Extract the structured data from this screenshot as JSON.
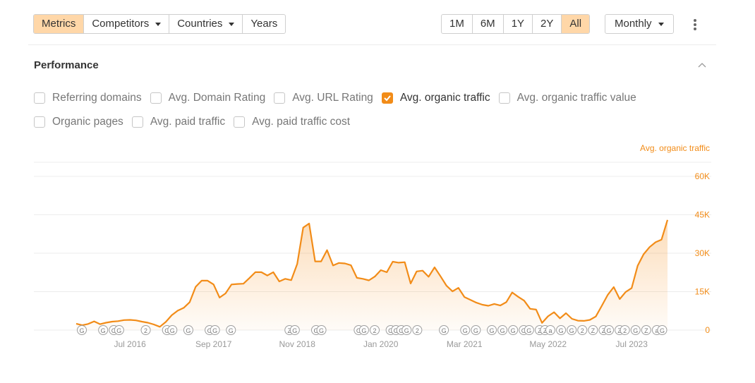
{
  "toolbar": {
    "left_segment": [
      {
        "label": "Metrics",
        "active": true,
        "dropdown": false
      },
      {
        "label": "Competitors",
        "active": false,
        "dropdown": true
      },
      {
        "label": "Countries",
        "active": false,
        "dropdown": true
      },
      {
        "label": "Years",
        "active": false,
        "dropdown": false
      }
    ],
    "range_segment": [
      {
        "label": "1M",
        "active": false
      },
      {
        "label": "6M",
        "active": false
      },
      {
        "label": "1Y",
        "active": false
      },
      {
        "label": "2Y",
        "active": false
      },
      {
        "label": "All",
        "active": true
      }
    ],
    "interval_label": "Monthly"
  },
  "section": {
    "title": "Performance"
  },
  "metrics_row1": [
    {
      "label": "Referring domains",
      "checked": false
    },
    {
      "label": "Avg. Domain Rating",
      "checked": false
    },
    {
      "label": "Avg. URL Rating",
      "checked": false
    },
    {
      "label": "Avg. organic traffic",
      "checked": true
    },
    {
      "label": "Avg. organic traffic value",
      "checked": false
    }
  ],
  "metrics_row2": [
    {
      "label": "Organic pages",
      "checked": false
    },
    {
      "label": "Avg. paid traffic",
      "checked": false
    },
    {
      "label": "Avg. paid traffic cost",
      "checked": false
    }
  ],
  "colors": {
    "accent": "#f28c18",
    "active_bg": "#ffd7a8",
    "grid": "#ececec",
    "tick_text": "#999999"
  },
  "chart_data": {
    "type": "area",
    "series": [
      {
        "name": "Avg. organic traffic",
        "values": [
          2500,
          1900,
          2400,
          3400,
          2300,
          2900,
          3300,
          3500,
          3900,
          4000,
          3800,
          3300,
          2900,
          2200,
          1300,
          3200,
          5800,
          7600,
          8700,
          10900,
          16900,
          19300,
          19300,
          17800,
          12700,
          14300,
          17800,
          18000,
          18100,
          20300,
          22600,
          22600,
          21300,
          22600,
          19000,
          20000,
          19500,
          25800,
          40000,
          41600,
          26800,
          26800,
          31200,
          25200,
          26200,
          26000,
          25300,
          20400,
          20000,
          19400,
          20900,
          23400,
          22600,
          26700,
          26300,
          26500,
          18200,
          22900,
          23200,
          20800,
          24500,
          21000,
          17300,
          15100,
          16500,
          12900,
          11800,
          10700,
          9900,
          9500,
          10200,
          9600,
          10900,
          14700,
          13000,
          11500,
          8300,
          8000,
          2800,
          5400,
          7000,
          4600,
          6600,
          4400,
          3700,
          3600,
          4000,
          5300,
          9500,
          13800,
          16800,
          12100,
          14900,
          16400,
          25100,
          29600,
          32400,
          34300,
          35300,
          43000
        ]
      }
    ],
    "x_tick_labels": [
      "Jul 2016",
      "Sep 2017",
      "Nov 2018",
      "Jan 2020",
      "Mar 2021",
      "May 2022",
      "Jul 2023"
    ],
    "x_tick_points": [
      9,
      23,
      37,
      51,
      65,
      79,
      93
    ],
    "y_ticks": [
      0,
      15000,
      30000,
      45000,
      60000
    ],
    "y_tick_labels": [
      "0",
      "15K",
      "30K",
      "45K",
      "60K"
    ],
    "ylim": [
      0,
      60000
    ],
    "y_axis_title": "Avg. organic traffic",
    "y_axis_position": "right",
    "grid": true,
    "annotations": [
      {
        "i": 0,
        "glyph": "G"
      },
      {
        "i": 4,
        "glyph": "G"
      },
      {
        "i": 6,
        "glyph": "G"
      },
      {
        "i": 7,
        "glyph": "G"
      },
      {
        "i": 12,
        "glyph": "2"
      },
      {
        "i": 16,
        "glyph": "G"
      },
      {
        "i": 17,
        "glyph": "G"
      },
      {
        "i": 20,
        "glyph": "G"
      },
      {
        "i": 24,
        "glyph": "G"
      },
      {
        "i": 25,
        "glyph": "G"
      },
      {
        "i": 28,
        "glyph": "G"
      },
      {
        "i": 39,
        "glyph": "Z"
      },
      {
        "i": 40,
        "glyph": "G"
      },
      {
        "i": 44,
        "glyph": "G"
      },
      {
        "i": 45,
        "glyph": "G"
      },
      {
        "i": 52,
        "glyph": "G"
      },
      {
        "i": 53,
        "glyph": "G"
      },
      {
        "i": 55,
        "glyph": "2"
      },
      {
        "i": 58,
        "glyph": "G"
      },
      {
        "i": 59,
        "glyph": "G"
      },
      {
        "i": 60,
        "glyph": "G"
      },
      {
        "i": 61,
        "glyph": "G"
      },
      {
        "i": 63,
        "glyph": "2"
      },
      {
        "i": 68,
        "glyph": "G"
      },
      {
        "i": 72,
        "glyph": "G"
      },
      {
        "i": 74,
        "glyph": "G"
      },
      {
        "i": 77,
        "glyph": "G"
      },
      {
        "i": 79,
        "glyph": "G"
      },
      {
        "i": 81,
        "glyph": "G"
      },
      {
        "i": 83,
        "glyph": "G"
      },
      {
        "i": 84,
        "glyph": "G"
      },
      {
        "i": 86,
        "glyph": "Z"
      },
      {
        "i": 87,
        "glyph": "Z"
      },
      {
        "i": 88,
        "glyph": "a"
      },
      {
        "i": 90,
        "glyph": "G"
      },
      {
        "i": 92,
        "glyph": "G"
      },
      {
        "i": 94,
        "glyph": "2"
      },
      {
        "i": 96,
        "glyph": "Z"
      },
      {
        "i": 98,
        "glyph": "Z"
      },
      {
        "i": 99,
        "glyph": "G"
      },
      {
        "i": 101,
        "glyph": "Z"
      },
      {
        "i": 102,
        "glyph": "2"
      },
      {
        "i": 104,
        "glyph": "G"
      },
      {
        "i": 106,
        "glyph": "Z"
      },
      {
        "i": 108,
        "glyph": "a"
      },
      {
        "i": 109,
        "glyph": "G"
      }
    ]
  }
}
